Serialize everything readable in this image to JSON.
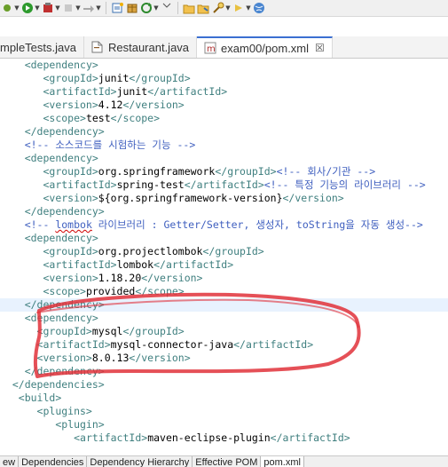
{
  "toolbar": {
    "buttons": [
      "debug-dropdown-icon",
      "run-icon",
      "run-dropdown-icon",
      "stop-icon",
      "record-icon",
      "publish-icon",
      "new-wizard-icon",
      "open-type-icon",
      "package-icon",
      "refresh-icon",
      "open-task-icon",
      "open-folder-icon",
      "search-icon",
      "next-annotation-icon",
      "previous-icon",
      "globe-icon"
    ]
  },
  "tabs": [
    {
      "label": "mpleTests.java",
      "icon": "java-file-icon",
      "active": false
    },
    {
      "label": "Restaurant.java",
      "icon": "java-file-icon",
      "active": false
    },
    {
      "label": "exam00/pom.xml",
      "icon": "maven-pom-icon",
      "active": true,
      "close": "☒"
    }
  ],
  "code_lines": [
    {
      "indent": "    ",
      "parts": [
        [
          "t",
          "<dependency>"
        ]
      ]
    },
    {
      "indent": "       ",
      "parts": [
        [
          "t",
          "<groupId>"
        ],
        [
          "x",
          "junit"
        ],
        [
          "t",
          "</groupId>"
        ]
      ]
    },
    {
      "indent": "       ",
      "parts": [
        [
          "t",
          "<artifactId>"
        ],
        [
          "x",
          "junit"
        ],
        [
          "t",
          "</artifactId>"
        ]
      ]
    },
    {
      "indent": "       ",
      "parts": [
        [
          "t",
          "<version>"
        ],
        [
          "x",
          "4.12"
        ],
        [
          "t",
          "</version>"
        ]
      ]
    },
    {
      "indent": "       ",
      "parts": [
        [
          "t",
          "<scope>"
        ],
        [
          "x",
          "test"
        ],
        [
          "t",
          "</scope>"
        ]
      ]
    },
    {
      "indent": "    ",
      "parts": [
        [
          "t",
          "</dependency>"
        ]
      ]
    },
    {
      "indent": "    ",
      "parts": [
        [
          "c",
          "<!-- 소스코드를 시험하는 기능 -->"
        ]
      ]
    },
    {
      "indent": "    ",
      "parts": [
        [
          "t",
          "<dependency>"
        ]
      ]
    },
    {
      "indent": "       ",
      "parts": [
        [
          "t",
          "<groupId>"
        ],
        [
          "x",
          "org.springframework"
        ],
        [
          "t",
          "</groupId>"
        ],
        [
          "c",
          "<!-- 회사/기관 -->"
        ]
      ]
    },
    {
      "indent": "       ",
      "parts": [
        [
          "t",
          "<artifactId>"
        ],
        [
          "x",
          "spring-test"
        ],
        [
          "t",
          "</artifactId>"
        ],
        [
          "c",
          "<!-- 특정 기능의 라이브러리 -->"
        ]
      ]
    },
    {
      "indent": "       ",
      "parts": [
        [
          "t",
          "<version>"
        ],
        [
          "x",
          "${org.springframework-version}"
        ],
        [
          "t",
          "</version>"
        ]
      ]
    },
    {
      "indent": "    ",
      "parts": [
        [
          "t",
          "</dependency>"
        ]
      ]
    },
    {
      "indent": "    ",
      "parts": [
        [
          "c",
          "<!-- "
        ],
        [
          "cs",
          "lombok"
        ],
        [
          "c",
          " 라이브러리 : Getter/Setter, 생성자, toString을 자동 생성-->"
        ]
      ]
    },
    {
      "indent": "    ",
      "parts": [
        [
          "t",
          "<dependency>"
        ]
      ]
    },
    {
      "indent": "       ",
      "parts": [
        [
          "t",
          "<groupId>"
        ],
        [
          "x",
          "org.projectlombok"
        ],
        [
          "t",
          "</groupId>"
        ]
      ]
    },
    {
      "indent": "       ",
      "parts": [
        [
          "t",
          "<artifactId>"
        ],
        [
          "x",
          "lombok"
        ],
        [
          "t",
          "</artifactId>"
        ]
      ]
    },
    {
      "indent": "       ",
      "parts": [
        [
          "t",
          "<version>"
        ],
        [
          "x",
          "1.18.20"
        ],
        [
          "t",
          "</version>"
        ]
      ]
    },
    {
      "indent": "       ",
      "parts": [
        [
          "t",
          "<scope>"
        ],
        [
          "x",
          "provided"
        ],
        [
          "t",
          "</scope>"
        ]
      ]
    },
    {
      "indent": "    ",
      "parts": [
        [
          "t",
          "</dependency>"
        ]
      ],
      "highlight": true
    },
    {
      "indent": "    ",
      "parts": [
        [
          "t",
          "<dependency>"
        ]
      ]
    },
    {
      "indent": "      ",
      "parts": [
        [
          "t",
          "<groupId>"
        ],
        [
          "x",
          "mysql"
        ],
        [
          "t",
          "</groupId>"
        ]
      ]
    },
    {
      "indent": "      ",
      "parts": [
        [
          "t",
          "<artifactId>"
        ],
        [
          "x",
          "mysql-connector-java"
        ],
        [
          "t",
          "</artifactId>"
        ]
      ]
    },
    {
      "indent": "      ",
      "parts": [
        [
          "t",
          "<version>"
        ],
        [
          "x",
          "8.0.13"
        ],
        [
          "t",
          "</version>"
        ]
      ]
    },
    {
      "indent": "    ",
      "parts": [
        [
          "t",
          "</dependency>"
        ]
      ]
    },
    {
      "indent": "  ",
      "parts": [
        [
          "t",
          "</dependencies>"
        ]
      ]
    },
    {
      "indent": "   ",
      "parts": [
        [
          "t",
          "<build>"
        ]
      ]
    },
    {
      "indent": "      ",
      "parts": [
        [
          "t",
          "<plugins>"
        ]
      ]
    },
    {
      "indent": "         ",
      "parts": [
        [
          "t",
          "<plugin>"
        ]
      ]
    },
    {
      "indent": "            ",
      "parts": [
        [
          "t",
          "<artifactId>"
        ],
        [
          "x",
          "maven-eclipse-plugin"
        ],
        [
          "t",
          "</artifactId>"
        ]
      ]
    }
  ],
  "bottom_tabs": [
    {
      "label": "ew",
      "active": false
    },
    {
      "label": "Dependencies",
      "active": false
    },
    {
      "label": "Dependency Hierarchy",
      "active": false
    },
    {
      "label": "Effective POM",
      "active": false
    },
    {
      "label": "pom.xml",
      "active": true
    }
  ],
  "colors": {
    "tag": "#3f7f7f",
    "comment": "#3f5fbf",
    "text": "#000000",
    "annotation": "#e0313a",
    "active_tab_accent": "#3b6fd1"
  }
}
